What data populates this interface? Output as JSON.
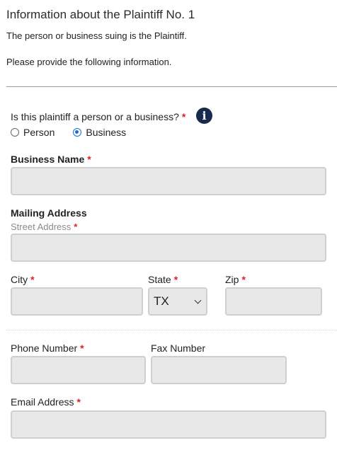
{
  "header": {
    "title": "Information about the Plaintiff No. 1",
    "description": "The person or business suing is the Plaintiff.",
    "instruction": "Please provide the following information."
  },
  "type_question": {
    "label": "Is this plaintiff a person or a business?",
    "required_mark": "*",
    "options": [
      {
        "label": "Person",
        "selected": false
      },
      {
        "label": "Business",
        "selected": true
      }
    ],
    "info_glyph": "i"
  },
  "business_name": {
    "label": "Business Name",
    "required_mark": "*",
    "value": ""
  },
  "mailing_address": {
    "heading": "Mailing Address",
    "street_label": "Street Address",
    "street_required": "*",
    "street_value": ""
  },
  "city": {
    "label": "City",
    "required_mark": "*",
    "value": ""
  },
  "state": {
    "label": "State",
    "required_mark": "*",
    "selected": "TX"
  },
  "zip": {
    "label": "Zip",
    "required_mark": "*",
    "value": ""
  },
  "phone": {
    "label": "Phone Number",
    "required_mark": "*",
    "value": ""
  },
  "fax": {
    "label": "Fax Number",
    "value": ""
  },
  "email": {
    "label": "Email Address",
    "required_mark": "*",
    "value": ""
  },
  "colors": {
    "required": "#dd2222",
    "radio_selected": "#1a6fd1",
    "info_icon_bg": "#1a2a4e",
    "field_bg": "#e8e8e8"
  },
  "icons": {
    "info": "info-circle-icon",
    "dropdown": "chevron-down-icon"
  }
}
